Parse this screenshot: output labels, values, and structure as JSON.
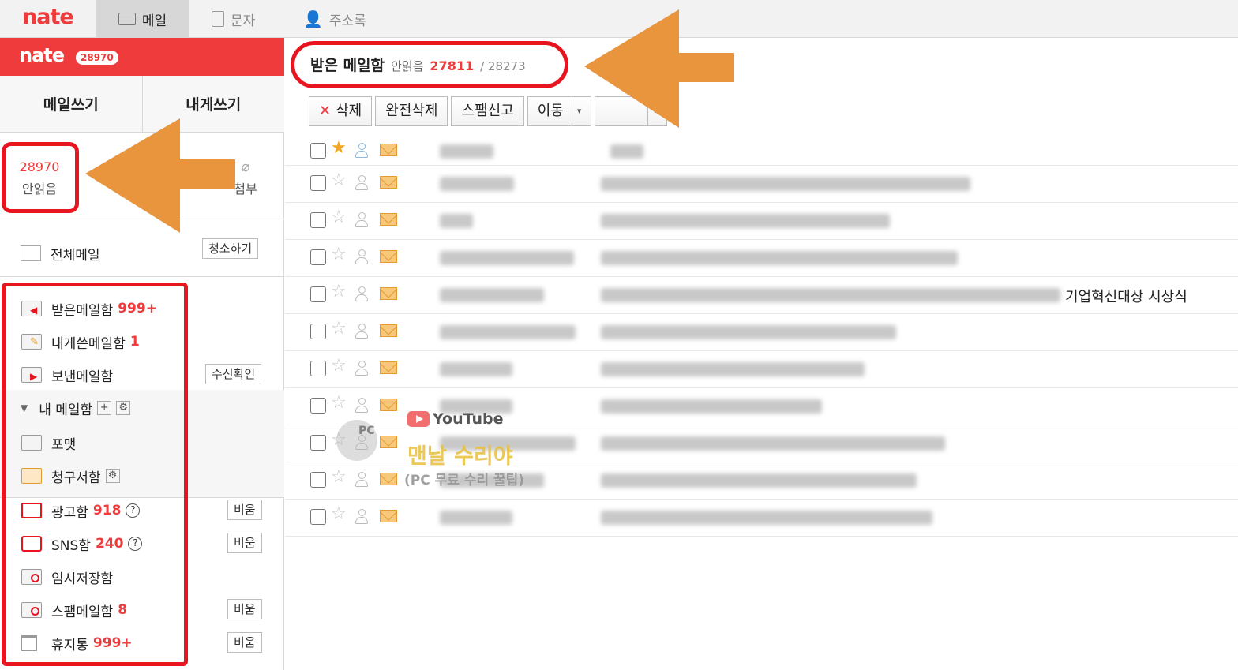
{
  "topnav": {
    "brand": "nate",
    "tabs": [
      {
        "label": "메일",
        "icon": "mail-icon",
        "active": true
      },
      {
        "label": "문자",
        "icon": "phone-icon",
        "active": false
      },
      {
        "label": "주소록",
        "icon": "contact-icon",
        "active": false
      }
    ]
  },
  "sidebar": {
    "logo": "nate",
    "count_badge": "28970",
    "write_mail": "메일쓰기",
    "write_self": "내게쓰기",
    "stats": {
      "unread_count": "28970",
      "unread_label": "안읽음",
      "attach_label": "첨부"
    },
    "all_mail": {
      "label": "전체메일",
      "button": "청소하기"
    },
    "folders": [
      {
        "label": "받은메일함",
        "count": "999+",
        "icon": "inbox-folder-icon"
      },
      {
        "label": "내게쓴메일함",
        "count": "1",
        "icon": "self-mail-folder-icon"
      },
      {
        "label": "보낸메일함",
        "count": "",
        "icon": "sent-folder-icon",
        "button": "수신확인"
      }
    ],
    "my_mailbox": {
      "label": "내 메일함",
      "add": "+",
      "settings": "⚙"
    },
    "custom_folders": [
      {
        "label": "포맷",
        "icon": "folder-icon"
      },
      {
        "label": "청구서함",
        "icon": "bill-folder-icon"
      }
    ],
    "special": [
      {
        "label": "광고함",
        "count": "918",
        "help": "?",
        "button": "비움",
        "icon": "ad-bag-icon"
      },
      {
        "label": "SNS함",
        "count": "240",
        "help": "?",
        "button": "비움",
        "icon": "sns-people-icon"
      },
      {
        "label": "임시저장함",
        "count": "",
        "icon": "draft-folder-icon"
      },
      {
        "label": "스팸메일함",
        "count": "8",
        "button": "비움",
        "icon": "spam-folder-icon"
      },
      {
        "label": "휴지통",
        "count": "999+",
        "button": "비움",
        "icon": "trash-icon"
      }
    ]
  },
  "main": {
    "title": "받은 메일함",
    "unread_label": "안읽음",
    "unread_count": "27811",
    "total": "/ 28273",
    "toolbar": {
      "delete": "삭제",
      "delete_x": "✕",
      "perm_delete": "완전삭제",
      "spam_report": "스팸신고",
      "move": "이동",
      "dropdown": "▾"
    },
    "visible_subject_text": "기업혁신대상 시상식"
  },
  "watermark": {
    "platform": "YouTube",
    "pc": "PC",
    "channel": "맨날 수리야",
    "tagline": "(PC 무료 수리 꿀팁)"
  },
  "colors": {
    "brand_red": "#ef3b3b",
    "annotation_red": "#e8141f",
    "annotation_orange": "#e8953e"
  }
}
